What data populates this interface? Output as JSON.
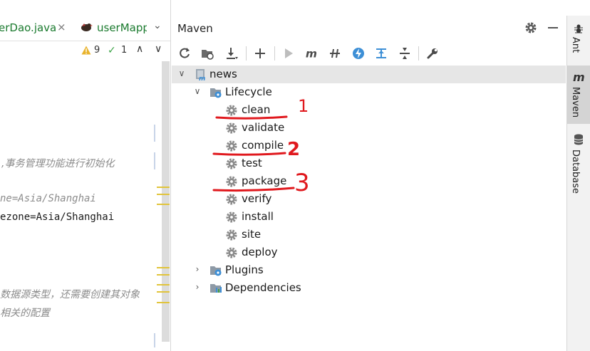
{
  "editor": {
    "tabs": [
      {
        "label": "erDao.java",
        "close": "×"
      },
      {
        "label": "userMapp"
      }
    ],
    "tab_overflow": "⌄",
    "inspections": {
      "warnings": "9",
      "passed": "1"
    },
    "nav_up": "∧",
    "nav_down": "∨",
    "code_lines": [
      {
        "text": ",事务管理功能进行初始化",
        "style": "comment"
      },
      {
        "text": "ne=Asia/Shanghai",
        "style": "faded"
      },
      {
        "text": "ezone=Asia/Shanghai",
        "style": "dark"
      },
      {
        "text": "数据源类型，还需要创建其对象",
        "style": "comment"
      },
      {
        "text": "相关的配置",
        "style": "comment"
      }
    ]
  },
  "maven": {
    "title": "Maven",
    "toolbar_icons": [
      "reload-icon",
      "generate-sources-icon",
      "download-icon",
      "add-icon",
      "run-icon",
      "execute-goal-icon",
      "toggle-offline-icon",
      "skip-tests-icon",
      "show-dependencies-icon",
      "collapse-all-icon",
      "settings-wrench-icon"
    ],
    "tree": {
      "project": "news",
      "lifecycle": {
        "label": "Lifecycle",
        "goals": [
          "clean",
          "validate",
          "compile",
          "test",
          "package",
          "verify",
          "install",
          "site",
          "deploy"
        ]
      },
      "plugins": "Plugins",
      "dependencies": "Dependencies"
    }
  },
  "annotations": {
    "numbers": [
      "1",
      "2",
      "3"
    ],
    "color": "#e0191e"
  },
  "right_stripe": {
    "items": [
      "Ant",
      "Maven",
      "Database"
    ]
  },
  "colors": {
    "tab_text": "#1a7a2e",
    "selected_row": "#e6e6e6",
    "warning": "#e1c43a",
    "annotation_red": "#e0191e"
  }
}
